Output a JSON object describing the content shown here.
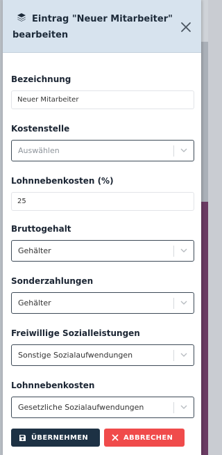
{
  "dialog": {
    "title": "Eintrag \"Neuer Mitarbeiter\" bearbeiten",
    "icon": "layers-icon",
    "close_icon": "close-icon"
  },
  "fields": {
    "bezeichnung": {
      "label": "Bezeichnung",
      "value": "Neuer Mitarbeiter"
    },
    "kostenstelle": {
      "label": "Kostenstelle",
      "placeholder": "Auswählen"
    },
    "lnk_percent": {
      "label": "Lohnnebenkosten (%)",
      "value": "25"
    },
    "bruttogehalt": {
      "label": "Bruttogehalt",
      "value": "Gehälter"
    },
    "sonderzahlungen": {
      "label": "Sonderzahlungen",
      "value": "Gehälter"
    },
    "freiwillige": {
      "label": "Freiwillige Sozialleistungen",
      "value": "Sonstige Sozialaufwendungen"
    },
    "lohnnebenkosten": {
      "label": "Lohnnebenkosten",
      "value": "Gesetzliche Sozialaufwendungen"
    }
  },
  "actions": {
    "save_label": "ÜBERNEHMEN",
    "cancel_label": "ABBRECHEN"
  },
  "colors": {
    "header_bg": "#d7e3ee",
    "primary": "#1d3144",
    "danger": "#f04b4b"
  }
}
